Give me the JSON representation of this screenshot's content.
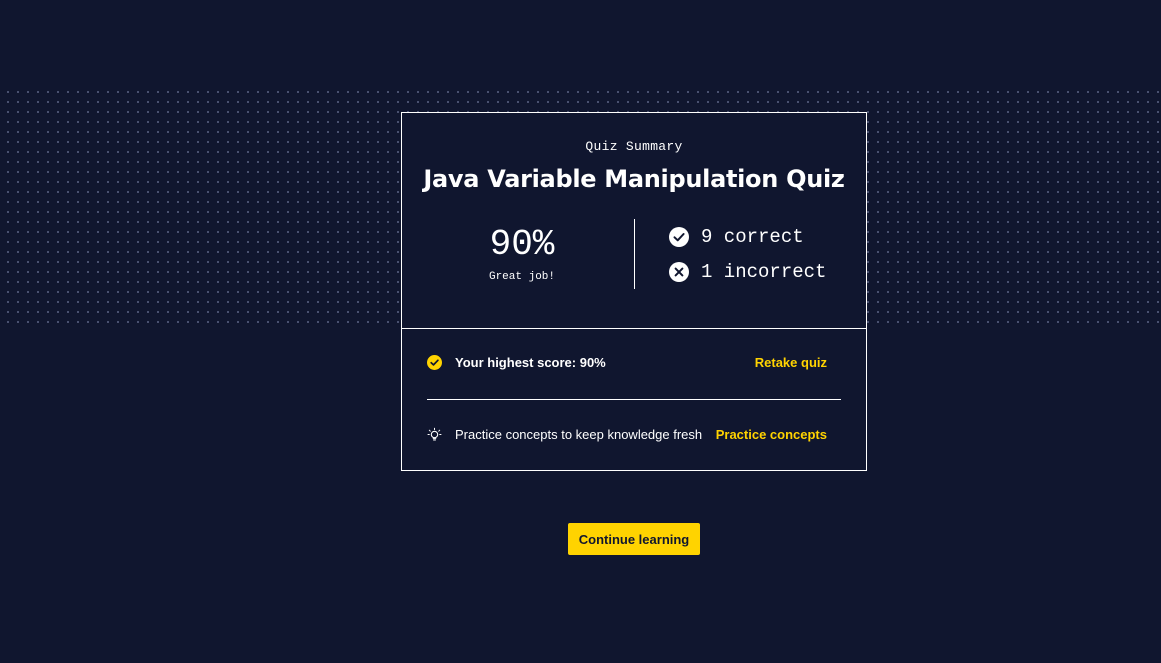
{
  "summary": {
    "eyebrow": "Quiz Summary",
    "title": "Java Variable Manipulation Quiz",
    "score_percent": "90%",
    "score_message": "Great job!",
    "correct_text": "9 correct",
    "incorrect_text": "1 incorrect",
    "correct_count": 9,
    "incorrect_count": 1
  },
  "highest_score": {
    "label": "Your highest score: 90%",
    "link": "Retake quiz",
    "icon": "check-circle-icon"
  },
  "practice": {
    "label": "Practice concepts to keep knowledge fresh",
    "link": "Practice concepts",
    "icon": "lightbulb-icon"
  },
  "continue_button": "Continue learning",
  "colors": {
    "background": "#10162f",
    "accent": "#ffd300",
    "text": "#ffffff"
  }
}
